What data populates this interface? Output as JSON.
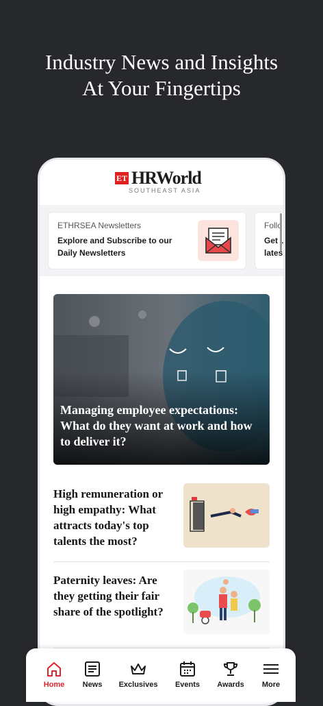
{
  "promo": {
    "line1": "Industry News and Insights",
    "line2": "At Your Fingertips"
  },
  "brand": {
    "et": "ET",
    "name": "HRWorld",
    "region": "SOUTHEAST ASIA"
  },
  "newsletters": [
    {
      "title": "ETHRSEA Newsletters",
      "desc_line1": "Explore and Subscribe to our",
      "desc_line2": "Daily Newsletters",
      "icon": "newsletter-envelope-icon"
    },
    {
      "title": "Follo",
      "desc_line1": "Get u",
      "desc_line2": "lates"
    }
  ],
  "hero": {
    "title": "Managing employee expectations: What do they want at work and how to deliver it?"
  },
  "articles": [
    {
      "title": "High remuneration or high empathy: What attracts today's top talents the most?"
    },
    {
      "title": "Paternity leaves: Are they getting their fair share of the spotlight?"
    }
  ],
  "tabs": [
    {
      "label": "Home",
      "icon": "home-icon",
      "active": true
    },
    {
      "label": "News",
      "icon": "news-icon"
    },
    {
      "label": "Exclusives",
      "icon": "crown-icon"
    },
    {
      "label": "Events",
      "icon": "calendar-icon"
    },
    {
      "label": "Awards",
      "icon": "trophy-icon"
    },
    {
      "label": "More",
      "icon": "menu-icon"
    }
  ],
  "colors": {
    "background": "#27282c",
    "accent": "#e0242a",
    "brand_red": "#e02020"
  }
}
